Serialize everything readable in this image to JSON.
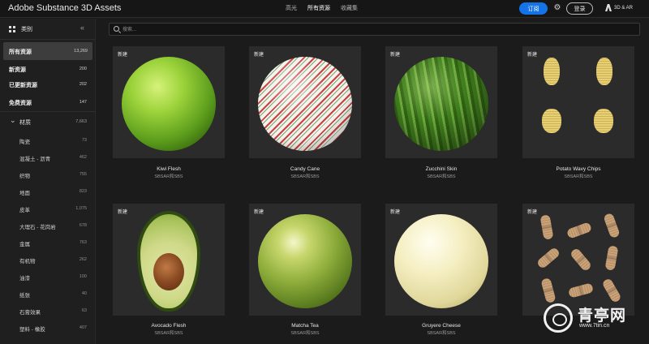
{
  "header": {
    "app_title": "Adobe Substance 3D Assets",
    "nav": [
      "高光",
      "所有资源",
      "收藏集"
    ],
    "nav_active_index": 1,
    "subscribe_label": "订阅",
    "login_label": "登录",
    "brand_label": "3D & AR",
    "accent_color": "#1473e6"
  },
  "sidebar": {
    "title": "类别",
    "top_items": [
      {
        "label": "所有资源",
        "count": "13,269",
        "selected": true
      },
      {
        "label": "新资源",
        "count": "200"
      },
      {
        "label": "已更新资源",
        "count": "202"
      },
      {
        "label": "免费资源",
        "count": "147"
      }
    ],
    "group": {
      "label": "材质",
      "count": "7,663"
    },
    "sub_items": [
      {
        "label": "陶瓷",
        "count": "73"
      },
      {
        "label": "混凝土 - 沥青",
        "count": "462"
      },
      {
        "label": "织物",
        "count": "755"
      },
      {
        "label": "地面",
        "count": "823"
      },
      {
        "label": "皮革",
        "count": "1,075"
      },
      {
        "label": "大理石 - 花岗岩",
        "count": "678"
      },
      {
        "label": "金属",
        "count": "763"
      },
      {
        "label": "有机物",
        "count": "262"
      },
      {
        "label": "油漆",
        "count": "100"
      },
      {
        "label": "纸张",
        "count": "40"
      },
      {
        "label": "石膏效果",
        "count": "63"
      },
      {
        "label": "塑料 - 橡胶",
        "count": "407"
      }
    ]
  },
  "search": {
    "placeholder": "搜索..."
  },
  "cards": [
    {
      "name": "Kiwi Flesh",
      "format": "SBSAR和SBS",
      "badge": "新建"
    },
    {
      "name": "Candy Cane",
      "format": "SBSAR和SBS",
      "badge": "新建"
    },
    {
      "name": "Zucchini Skin",
      "format": "SBSAR和SBS",
      "badge": "新建"
    },
    {
      "name": "Potato Wavy Chips",
      "format": "SBSAR和SBS",
      "badge": "新建"
    },
    {
      "name": "Avocado Flesh",
      "format": "SBSAR和SBS",
      "badge": "新建"
    },
    {
      "name": "Matcha Tea",
      "format": "SBSAR和SBS",
      "badge": "新建"
    },
    {
      "name": "Gruyere Cheese",
      "format": "SBSAR和SBS",
      "badge": "新建"
    },
    {
      "badge": "新建"
    }
  ],
  "watermark": {
    "text": "青亭网",
    "url": "www.7tin.cn"
  }
}
